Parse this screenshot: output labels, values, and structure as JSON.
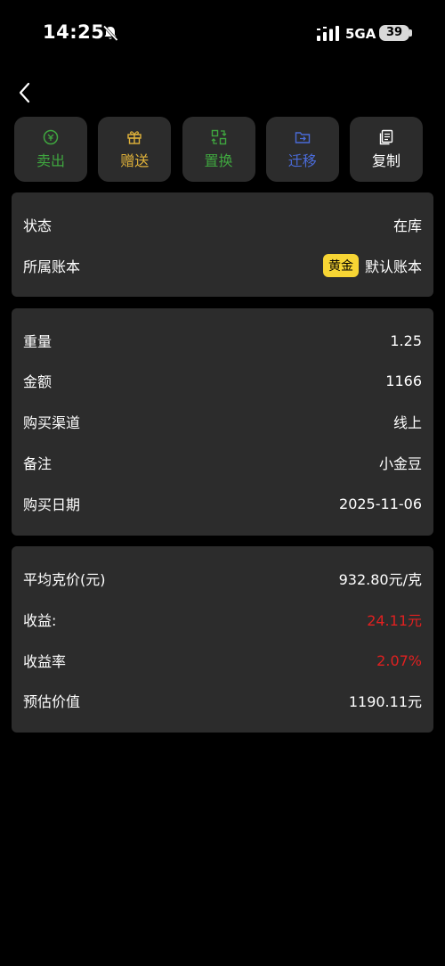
{
  "status_bar": {
    "time": "14:25",
    "network": "5GA",
    "battery": "39"
  },
  "actions": [
    {
      "label": "卖出",
      "color": "#3fa63f",
      "icon": "sell-icon"
    },
    {
      "label": "赠送",
      "color": "#e0b23a",
      "icon": "gift-icon"
    },
    {
      "label": "置换",
      "color": "#3fa63f",
      "icon": "exchange-icon"
    },
    {
      "label": "迁移",
      "color": "#4a6bd8",
      "icon": "migrate-icon"
    },
    {
      "label": "复制",
      "color": "#ffffff",
      "icon": "copy-icon"
    }
  ],
  "card1": {
    "status": {
      "label": "状态",
      "value": "在库"
    },
    "account": {
      "label": "所属账本",
      "badge": "黄金",
      "value": "默认账本"
    }
  },
  "card2": {
    "weight": {
      "label": "重量",
      "value": "1.25"
    },
    "amount": {
      "label": "金额",
      "value": "1166"
    },
    "channel": {
      "label": "购买渠道",
      "value": "线上"
    },
    "note": {
      "label": "备注",
      "value": "小金豆"
    },
    "date": {
      "label": "购买日期",
      "value": "2025-11-06"
    }
  },
  "card3": {
    "avg_price": {
      "label": "平均克价(元)",
      "value": "932.80元/克"
    },
    "profit": {
      "label": "收益:",
      "value": "24.11元"
    },
    "profit_rate": {
      "label": "收益率",
      "value": "2.07%"
    },
    "estimate": {
      "label": "预估价值",
      "value": "1190.11元"
    }
  }
}
